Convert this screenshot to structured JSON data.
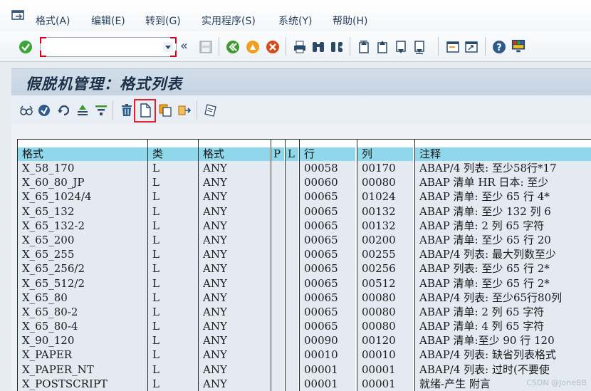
{
  "menu": {
    "items": [
      {
        "label": "格式(A)"
      },
      {
        "label": "编辑(E)"
      },
      {
        "label": "转到(G)"
      },
      {
        "label": "实用程序(S)"
      },
      {
        "label": "系统(Y)"
      },
      {
        "label": "帮助(H)"
      }
    ]
  },
  "command_field": {
    "value": "",
    "back_label": "«"
  },
  "title": "假脱机管理：格式列表",
  "table": {
    "headers": [
      "格式",
      "类",
      "格式",
      "P",
      "L",
      "行",
      "列",
      "注释"
    ],
    "rows": [
      [
        "X_58_170",
        "L",
        "ANY",
        "",
        "",
        "00058",
        "00170",
        "ABAP/4 列表: 至少58行*17"
      ],
      [
        "X_60_80_JP",
        "L",
        "ANY",
        "",
        "",
        "00060",
        "00080",
        "ABAP 清单 HR 日本: 至少"
      ],
      [
        "X_65_1024/4",
        "L",
        "ANY",
        "",
        "",
        "00065",
        "01024",
        "ABAP 清单: 至少 65 行 4*"
      ],
      [
        "X_65_132",
        "L",
        "ANY",
        "",
        "",
        "00065",
        "00132",
        "ABAP 清单: 至少 132 列 6"
      ],
      [
        "X_65_132-2",
        "L",
        "ANY",
        "",
        "",
        "00065",
        "00132",
        "ABAP 清单: 2 列 65 字符"
      ],
      [
        "X_65_200",
        "L",
        "ANY",
        "",
        "",
        "00065",
        "00200",
        "ABAP 清单: 至少 65 行 20"
      ],
      [
        "X_65_255",
        "L",
        "ANY",
        "",
        "",
        "00065",
        "00255",
        "ABAP/4 列表: 最大列数至少"
      ],
      [
        "X_65_256/2",
        "L",
        "ANY",
        "",
        "",
        "00065",
        "00256",
        "ABAP 列表: 至少 65 行 2*"
      ],
      [
        "X_65_512/2",
        "L",
        "ANY",
        "",
        "",
        "00065",
        "00512",
        "ABAP 清单: 至少 65 行 2*"
      ],
      [
        "X_65_80",
        "L",
        "ANY",
        "",
        "",
        "00065",
        "00080",
        "ABAP/4 列表: 至少65行80列"
      ],
      [
        "X_65_80-2",
        "L",
        "ANY",
        "",
        "",
        "00065",
        "00080",
        "ABAP 清单: 2 列 65 字符"
      ],
      [
        "X_65_80-4",
        "L",
        "ANY",
        "",
        "",
        "00065",
        "00080",
        "ABAP 清单: 4 列 65 字符"
      ],
      [
        "X_90_120",
        "L",
        "ANY",
        "",
        "",
        "00090",
        "00120",
        "ABAP 清单:至少 90 行 120"
      ],
      [
        "X_PAPER",
        "L",
        "ANY",
        "",
        "",
        "00010",
        "00010",
        "ABAP/4 列表: 缺省列表格式"
      ],
      [
        "X_PAPER_NT",
        "L",
        "ANY",
        "",
        "",
        "00001",
        "00001",
        "ABAP/4 列表: 过时(不要使"
      ],
      [
        "X_POSTSCRIPT",
        "L",
        "ANY",
        "",
        "",
        "00001",
        "00001",
        "就绪-产生 附言"
      ]
    ]
  },
  "watermark": "CSDN @JoneBB",
  "colors": {
    "header": "#8fd8ec",
    "body": "#e4eaf1",
    "highlight": "#e0202a"
  }
}
